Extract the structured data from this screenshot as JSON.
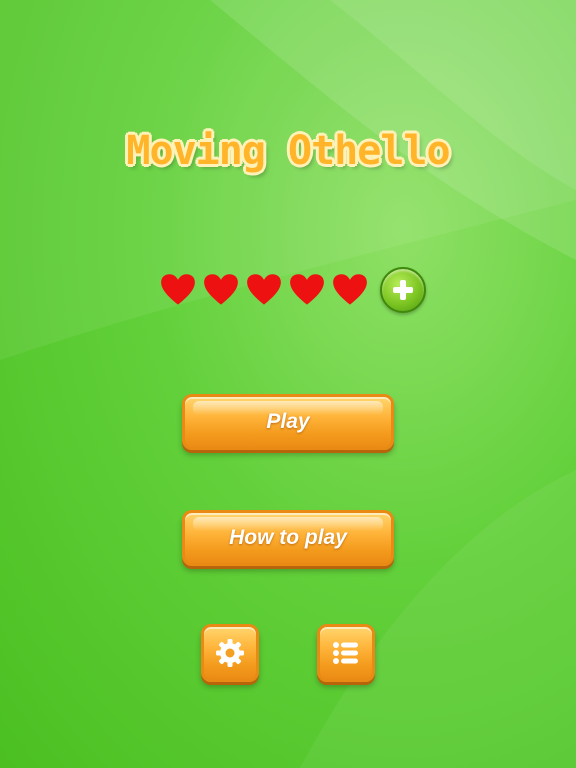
{
  "game": {
    "title": "Moving Othello"
  },
  "lives": {
    "count": 5,
    "icons": [
      "heart-icon",
      "heart-icon",
      "heart-icon",
      "heart-icon",
      "heart-icon"
    ],
    "add_icon": "plus-icon"
  },
  "menu": {
    "play_label": "Play",
    "how_to_play_label": "How to play",
    "settings_icon": "gear-icon",
    "list_icon": "list-icon"
  },
  "colors": {
    "background": "#5ccc34",
    "heart": "#ee1111",
    "button": "#ffb43a",
    "button_border": "#e98a14",
    "add_button": "#7cc522",
    "title": "#ffb429"
  }
}
